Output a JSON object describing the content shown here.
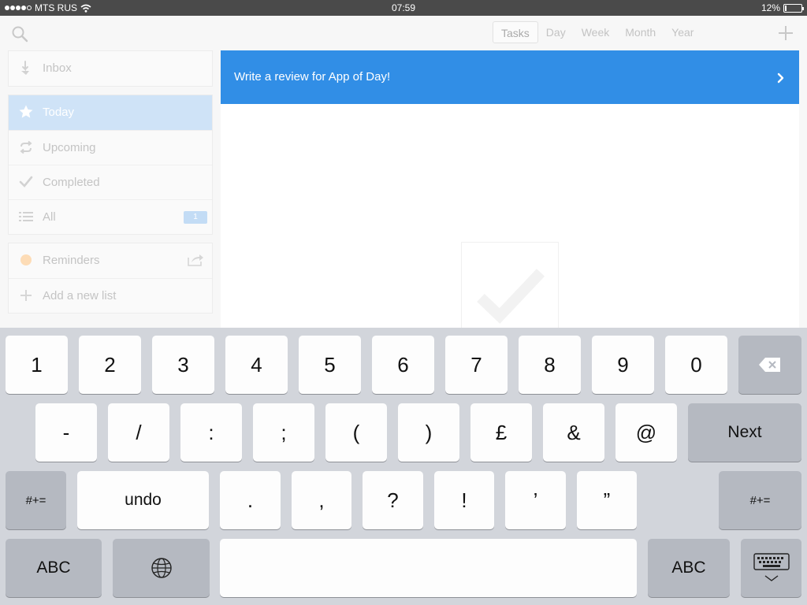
{
  "status_bar": {
    "carrier": "MTS RUS",
    "time": "07:59",
    "battery_percent": "12%",
    "battery_level": 0.12,
    "signal_bars": 4
  },
  "toolbar": {
    "search_icon": "search-icon",
    "tabs": [
      {
        "label": "Tasks",
        "active": true
      },
      {
        "label": "Day",
        "active": false
      },
      {
        "label": "Week",
        "active": false
      },
      {
        "label": "Month",
        "active": false
      },
      {
        "label": "Year",
        "active": false
      }
    ],
    "add_icon": "plus-icon"
  },
  "sidebar": {
    "items": [
      {
        "label": "Inbox",
        "icon": "inbox-icon"
      },
      {
        "label": "Today",
        "icon": "star-icon",
        "selected": true
      },
      {
        "label": "Upcoming",
        "icon": "repeat-icon"
      },
      {
        "label": "Completed",
        "icon": "check-icon"
      },
      {
        "label": "All",
        "icon": "list-icon",
        "badge": "1"
      }
    ],
    "lists": [
      {
        "label": "Reminders",
        "icon": "orange-dot-icon",
        "action_icon": "share-icon"
      },
      {
        "label": "Add a new list",
        "icon": "plus-icon"
      }
    ]
  },
  "task_editor": {
    "value": "Write a review for App of Day!",
    "chevron_icon": "chevron-right-icon"
  },
  "keyboard": {
    "row1": [
      "1",
      "2",
      "3",
      "4",
      "5",
      "6",
      "7",
      "8",
      "9",
      "0"
    ],
    "delete_icon": "backspace-icon",
    "row2": [
      "-",
      "/",
      ":",
      ";",
      "(",
      ")",
      "£",
      "&",
      "@"
    ],
    "next_label": "Next",
    "row3_left": "#+=",
    "undo_label": "undo",
    "row3": [
      ".",
      ",",
      "?",
      "!",
      "’",
      "”"
    ],
    "row3_right": "#+=",
    "abc_left": "ABC",
    "globe_icon": "globe-icon",
    "abc_right": "ABC",
    "dismiss_icon": "keyboard-dismiss-icon"
  },
  "colors": {
    "accent": "#318ee6",
    "selected_row": "#cfe3f7",
    "status_bar": "#4a4a4a",
    "keyboard_bg": "#d2d5db"
  }
}
